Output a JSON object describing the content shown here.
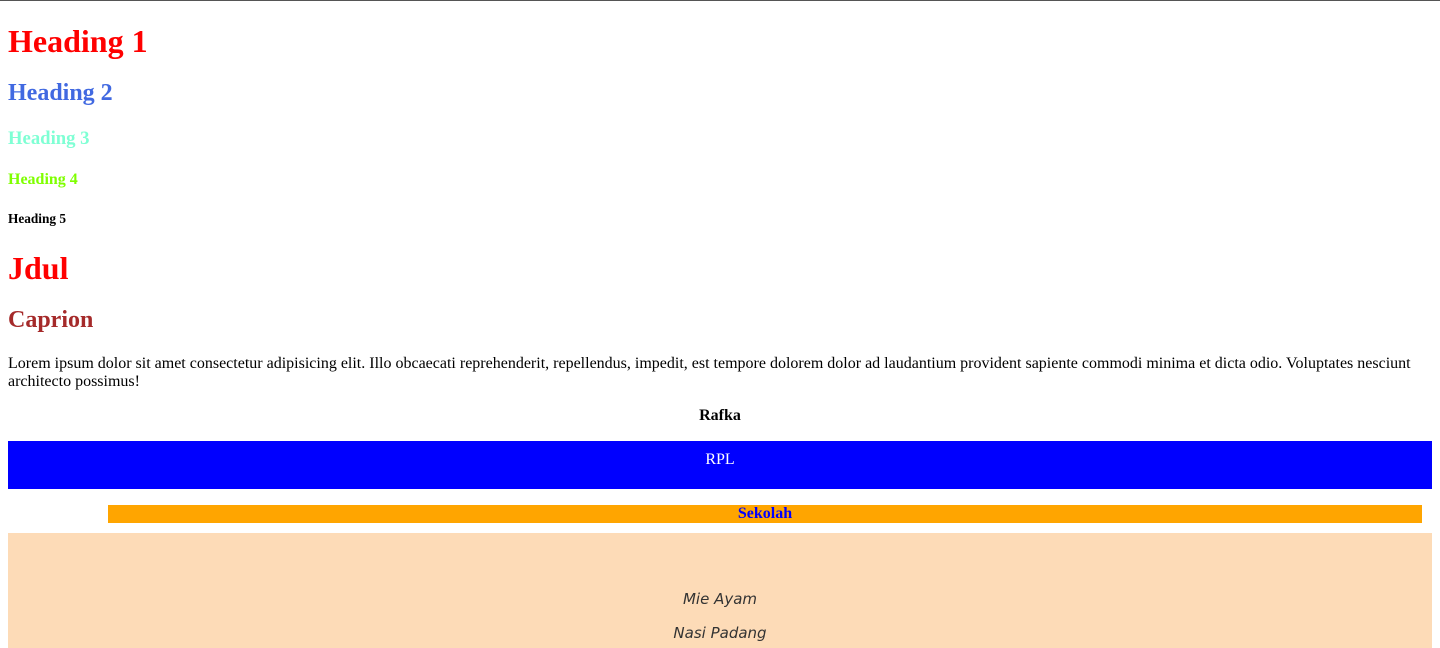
{
  "headings": {
    "h1": "Heading 1",
    "h2": "Heading 2",
    "h3": "Heading 3",
    "h4": "Heading 4",
    "h5": "Heading 5"
  },
  "title": "Jdul",
  "caption": "Caprion",
  "paragraph": "Lorem ipsum dolor sit amet consectetur adipisicing elit. Illo obcaecati reprehenderit, repellendus, impedit, est tempore dolorem dolor ad laudantium provident sapiente commodi minima et dicta odio. Voluptates nesciunt architecto possimus!",
  "name": "Rafka",
  "major_box": {
    "label": "RPL",
    "background": "#0000ff",
    "text_color": "#ffffff"
  },
  "school_bar": {
    "label": "Sekolah",
    "background": "#ffa500",
    "text_color": "#0000ff"
  },
  "food_box": {
    "background": "#fddbb7",
    "items": [
      "Mie Ayam",
      "Nasi Padang"
    ]
  },
  "colors": {
    "h1": "#ff0000",
    "h2": "#4169e1",
    "h3": "#7fffd4",
    "h4": "#7fff00",
    "h5": "#000000",
    "title": "#ff0000",
    "caption": "#a52a2a"
  }
}
